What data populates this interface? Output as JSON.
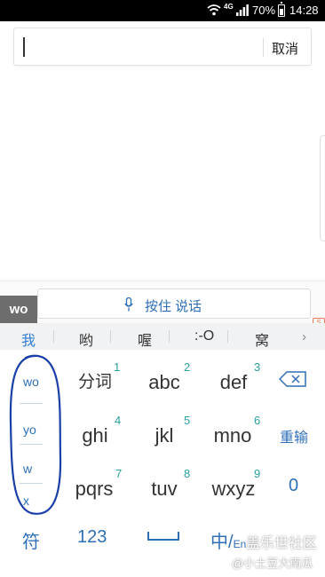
{
  "status_bar": {
    "network": "4G",
    "battery": "70%",
    "time": "14:28"
  },
  "search": {
    "cancel_label": "取消",
    "value": ""
  },
  "voice": {
    "label": "按住 说话"
  },
  "ime": {
    "pinyin_preview": "wo"
  },
  "candidates": [
    "我",
    "哟",
    "喔",
    ":-O",
    "窝"
  ],
  "keyboard": {
    "side_options": [
      "wo",
      "yo",
      "w",
      "x"
    ],
    "keys": [
      {
        "num": "1",
        "label": "分词"
      },
      {
        "num": "2",
        "label": "abc"
      },
      {
        "num": "3",
        "label": "def"
      },
      {
        "num": "4",
        "label": "ghi"
      },
      {
        "num": "5",
        "label": "jkl"
      },
      {
        "num": "6",
        "label": "mno"
      },
      {
        "num": "7",
        "label": "pqrs"
      },
      {
        "num": "8",
        "label": "tuv"
      },
      {
        "num": "9",
        "label": "wxyz"
      }
    ],
    "reenter_label": "重输",
    "zero_label": "0",
    "symbol_label": "符",
    "numeric_label": "123",
    "lang_label": "中/",
    "lang_sub": "En"
  },
  "watermark": {
    "line1": "盖乐世社区",
    "line2": "@小土豆大南瓜"
  },
  "colors": {
    "accent": "#2f6fb8",
    "number": "#2aa0a0",
    "scribble": "#1a3fa8"
  }
}
